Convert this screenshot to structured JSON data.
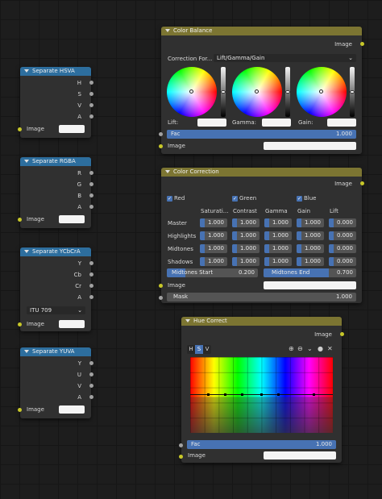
{
  "separate_hsva": {
    "title": "Separate HSVA",
    "outputs": [
      "H",
      "S",
      "V",
      "A"
    ],
    "input_label": "Image"
  },
  "separate_rgba": {
    "title": "Separate RGBA",
    "outputs": [
      "R",
      "G",
      "B",
      "A"
    ],
    "input_label": "Image"
  },
  "separate_ycbcra": {
    "title": "Separate YCbCrA",
    "outputs": [
      "Y",
      "Cb",
      "Cr",
      "A"
    ],
    "mode": "ITU 709",
    "input_label": "Image"
  },
  "separate_yuva": {
    "title": "Separate YUVA",
    "outputs": [
      "Y",
      "U",
      "V",
      "A"
    ],
    "input_label": "Image"
  },
  "color_balance": {
    "title": "Color Balance",
    "output_label": "Image",
    "correction_label": "Correction For...",
    "correction_value": "Lift/Gamma/Gain",
    "wheel_labels": [
      "Lift:",
      "Gamma:",
      "Gain:"
    ],
    "fac_label": "Fac",
    "fac_value": "1.000",
    "input_label": "Image"
  },
  "color_correction": {
    "title": "Color Correction",
    "output_label": "Image",
    "channels": [
      "Red",
      "Green",
      "Blue"
    ],
    "columns": [
      "Saturati...",
      "Contrast",
      "Gamma",
      "Gain",
      "Lift"
    ],
    "rows": [
      {
        "label": "Master",
        "values": [
          "1.000",
          "1.000",
          "1.000",
          "1.000",
          "0.000"
        ]
      },
      {
        "label": "Highlights",
        "values": [
          "1.000",
          "1.000",
          "1.000",
          "1.000",
          "0.000"
        ]
      },
      {
        "label": "Midtones",
        "values": [
          "1.000",
          "1.000",
          "1.000",
          "1.000",
          "0.000"
        ]
      },
      {
        "label": "Shadows",
        "values": [
          "1.000",
          "1.000",
          "1.000",
          "1.000",
          "0.000"
        ]
      }
    ],
    "midtones_start_label": "Midtones Start",
    "midtones_start_value": "0.200",
    "midtones_end_label": "Midtones End",
    "midtones_end_value": "0.700",
    "image_label": "Image",
    "mask_label": "Mask",
    "mask_value": "1.000"
  },
  "hue_correct": {
    "title": "Hue Correct",
    "output_label": "Image",
    "tabs": [
      "H",
      "S",
      "V"
    ],
    "active_tab": "S",
    "fac_label": "Fac",
    "fac_value": "1.000",
    "input_label": "Image"
  }
}
